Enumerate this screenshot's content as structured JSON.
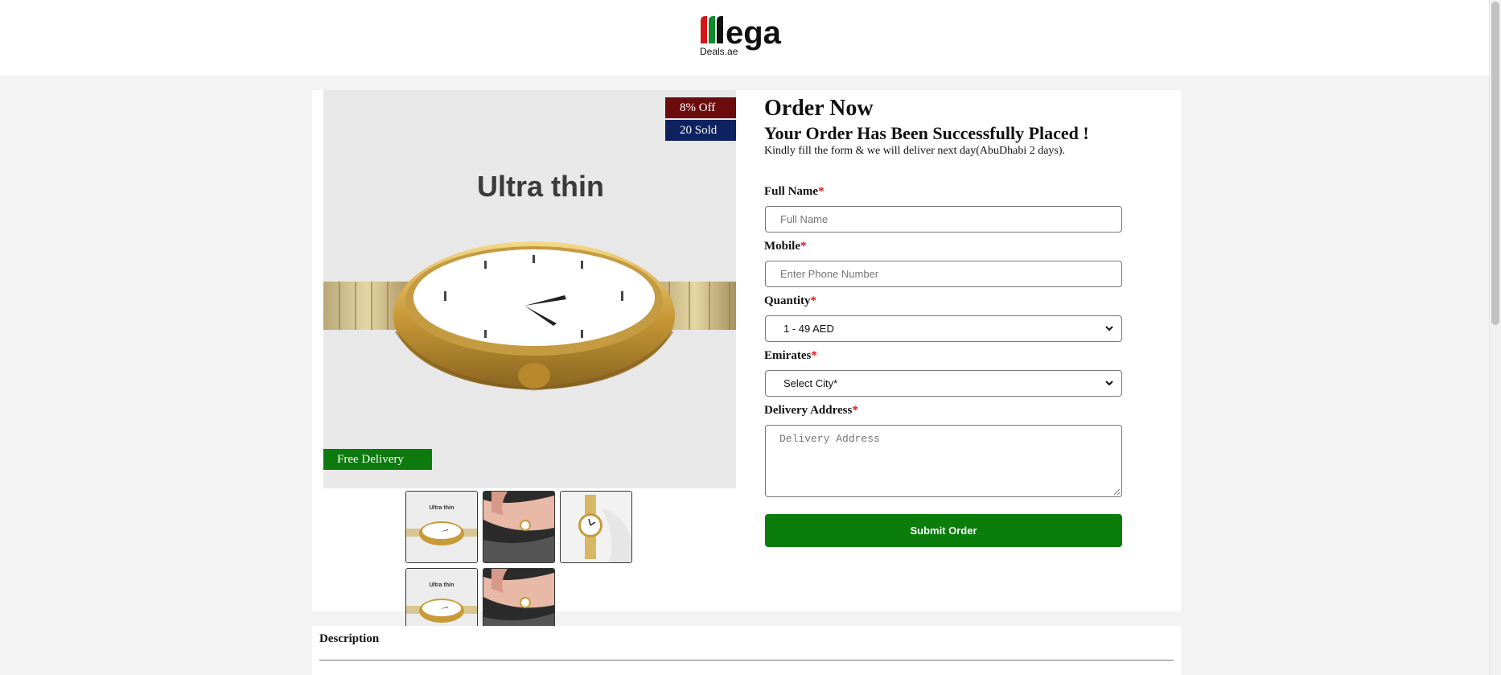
{
  "brand": {
    "logo_mark": "ega",
    "logo_sub": "Deals.ae"
  },
  "product": {
    "image_caption": "Ultra thin",
    "badges": {
      "discount": "8% Off",
      "sold": "20 Sold",
      "delivery": "Free Delivery"
    },
    "thumbnails": [
      {
        "caption": "Ultra thin"
      },
      {
        "caption": ""
      },
      {
        "caption": ""
      },
      {
        "caption": "Ultra thin"
      },
      {
        "caption": ""
      }
    ]
  },
  "order": {
    "title": "Order Now",
    "success_message": "Your Order Has Been Successfully Placed !",
    "note": "Kindly fill the form & we will deliver next day(AbuDhabi 2 days).",
    "required_mark": "*",
    "fields": {
      "full_name": {
        "label": "Full Name",
        "placeholder": "Full Name"
      },
      "mobile": {
        "label": "Mobile",
        "placeholder": "Enter Phone Number"
      },
      "quantity": {
        "label": "Quantity",
        "selected": "1 - 49 AED"
      },
      "emirates": {
        "label": "Emirates",
        "selected": "Select City*"
      },
      "address": {
        "label": "Delivery Address",
        "placeholder": "Delivery Address"
      }
    },
    "submit_label": "Submit Order"
  },
  "description": {
    "title": "Description"
  },
  "colors": {
    "page_bg": "#f3f3f3",
    "discount_badge": "#6b0d0d",
    "sold_badge": "#0e2260",
    "delivery_badge": "#0c7a0c",
    "submit_button": "#0a7d0a",
    "required": "#e01010",
    "logo_red": "#d4161c",
    "logo_green": "#0c8a2c"
  }
}
